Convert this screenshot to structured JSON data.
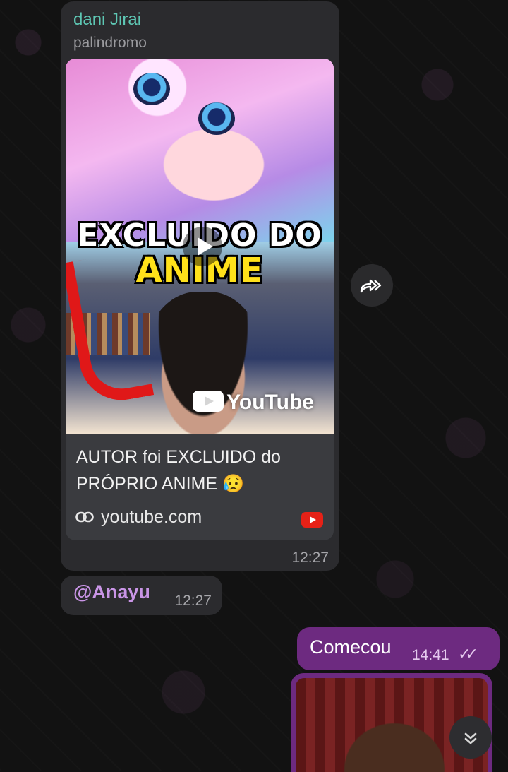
{
  "chat": {
    "link_message": {
      "sender": "dani Jirai",
      "subtitle": "palindromo",
      "thumbnail_text_line1": "EXCLUIDO DO",
      "thumbnail_text_line2": "ANIME",
      "thumbnail_watermark": "YouTube",
      "link_title": "AUTOR foi EXCLUIDO do PRÓPRIO ANIME 😥",
      "link_domain": "youtube.com",
      "time": "12:27"
    },
    "mention_message": {
      "text": "@Anayu",
      "time": "12:27"
    },
    "outgoing_message": {
      "text": "Comecou",
      "time": "14:41",
      "status": "read"
    }
  },
  "icons": {
    "forward": "forward-icon",
    "link": "link-icon",
    "youtube": "youtube-icon",
    "play": "play-icon",
    "read_ticks": "double-check-icon",
    "scroll_down": "chevron-double-down-icon"
  },
  "colors": {
    "sender_name": "#5ec7b4",
    "mention": "#c995e6",
    "outgoing_bubble": "#6d2a80",
    "incoming_bubble": "#2b2b2e"
  }
}
